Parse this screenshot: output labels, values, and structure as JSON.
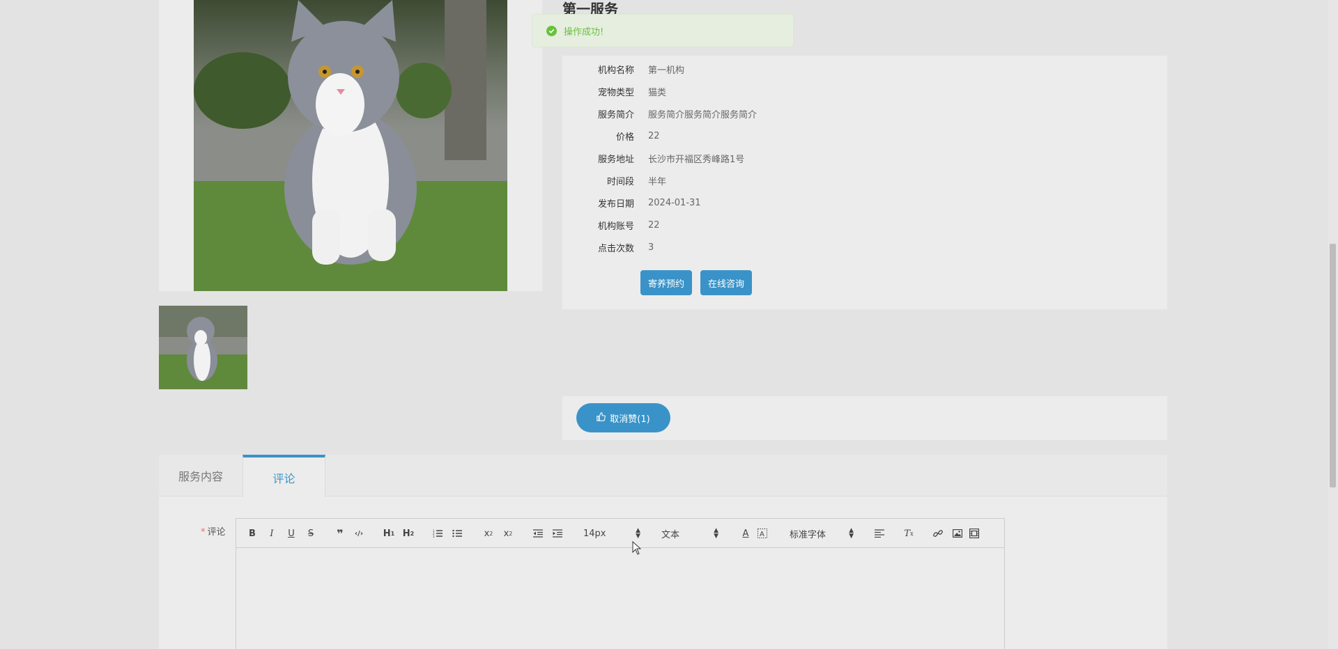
{
  "service": {
    "title": "第一服务"
  },
  "toast": {
    "message": "操作成功!"
  },
  "info": {
    "rows": [
      {
        "label": "机构名称",
        "value": "第一机构"
      },
      {
        "label": "宠物类型",
        "value": "猫类"
      },
      {
        "label": "服务简介",
        "value": "服务简介服务简介服务简介"
      },
      {
        "label": "价格",
        "value": "22"
      },
      {
        "label": "服务地址",
        "value": "长沙市开福区秀峰路1号"
      },
      {
        "label": "时间段",
        "value": "半年"
      },
      {
        "label": "发布日期",
        "value": "2024-01-31"
      },
      {
        "label": "机构账号",
        "value": "22"
      },
      {
        "label": "点击次数",
        "value": "3"
      }
    ]
  },
  "actions": {
    "book_label": "寄养预约",
    "consult_label": "在线咨询"
  },
  "like": {
    "label": "取消赞(1)"
  },
  "tabs": [
    {
      "label": "服务内容",
      "active": false
    },
    {
      "label": "评论",
      "active": true
    }
  ],
  "comment": {
    "required_mark": "*",
    "label": "评论"
  },
  "editor": {
    "font_size": "14px",
    "header_select": "文本",
    "font_family": "标准字体"
  },
  "colors": {
    "accent": "#3a93c8",
    "success": "#67c23a",
    "required": "#f56c6c"
  }
}
